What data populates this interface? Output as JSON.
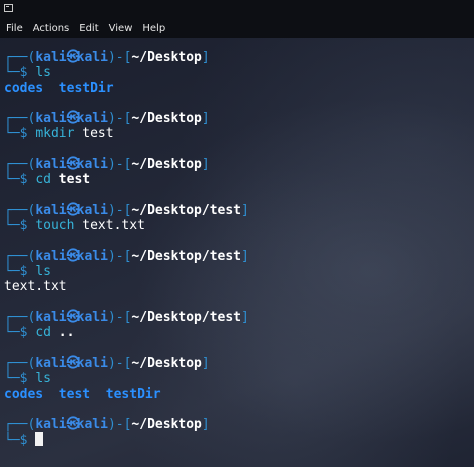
{
  "menu": {
    "items": [
      "File",
      "Actions",
      "Edit",
      "View",
      "Help"
    ]
  },
  "prompt": {
    "top_open": "┌──(",
    "user": "kali",
    "at": "㉿",
    "host": "kali",
    "close_mid": ")-[",
    "close_end": "]",
    "bottom": "└─$"
  },
  "blocks": [
    {
      "path": "~/Desktop",
      "command": "ls",
      "arg": "",
      "output": [
        [
          "codes",
          "dir"
        ],
        [
          "  ",
          "plain"
        ],
        [
          "testDir",
          "dir"
        ]
      ]
    },
    {
      "path": "~/Desktop",
      "command": "mkdir",
      "arg": "test",
      "output": null
    },
    {
      "path": "~/Desktop",
      "command": "cd",
      "arg": "test",
      "output": null
    },
    {
      "path": "~/Desktop/test",
      "command": "touch",
      "arg": "text.txt",
      "output": null
    },
    {
      "path": "~/Desktop/test",
      "command": "ls",
      "arg": "",
      "output": [
        [
          "text.txt",
          "plain"
        ]
      ]
    },
    {
      "path": "~/Desktop/test",
      "command": "cd",
      "arg": "..",
      "output": null
    },
    {
      "path": "~/Desktop",
      "command": "ls",
      "arg": "",
      "output": [
        [
          "codes",
          "dir"
        ],
        [
          "  ",
          "plain"
        ],
        [
          "test",
          "dir"
        ],
        [
          "  ",
          "plain"
        ],
        [
          "testDir",
          "dir"
        ]
      ]
    },
    {
      "path": "~/Desktop",
      "command": "",
      "arg": "",
      "output": null,
      "cursor": true
    }
  ],
  "colors": {
    "background": "#232838",
    "menubar": "#0d0f14",
    "frame": "#2f8fd1",
    "directory": "#2b90ff"
  }
}
